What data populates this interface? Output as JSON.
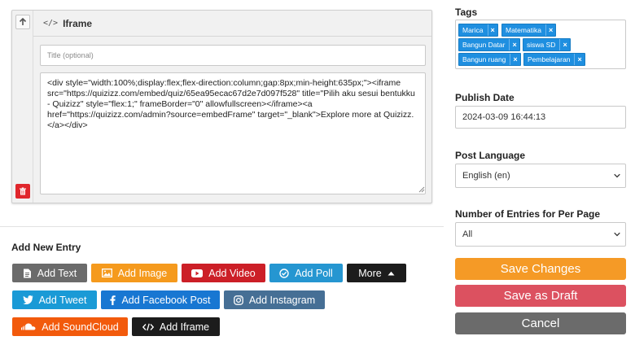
{
  "entry": {
    "header_code_glyph": "</>",
    "header_title": "Iframe",
    "title_placeholder": "Title (optional)",
    "code_value": "<div style=\"width:100%;display:flex;flex-direction:column;gap:8px;min-height:635px;\"><iframe src=\"https://quizizz.com/embed/quiz/65ea95ecac67d2e7d097f528\" title=\"Pilih aku sesui bentukku - Quizizz\" style=\"flex:1;\" frameBorder=\"0\" allowfullscreen></iframe><a href=\"https://quizizz.com/admin?source=embedFrame\" target=\"_blank\">Explore more at Quizizz.</a></div>"
  },
  "add_entry": {
    "title": "Add New Entry",
    "buttons": {
      "text": "Add Text",
      "image": "Add Image",
      "video": "Add Video",
      "poll": "Add Poll",
      "more": "More",
      "tweet": "Add Tweet",
      "facebook": "Add Facebook Post",
      "instagram": "Add Instagram",
      "soundcloud": "Add SoundCloud",
      "iframe": "Add Iframe"
    }
  },
  "sidebar": {
    "tags_label": "Tags",
    "tags": [
      "Marica",
      "Matematika",
      "Bangun Datar",
      "siswa SD",
      "Bangun ruang",
      "Pembelajaran"
    ],
    "tag_remove": "×",
    "publish_date_label": "Publish Date",
    "publish_date_value": "2024-03-09 16:44:13",
    "language_label": "Post Language",
    "language_value": "English (en)",
    "entries_label": "Number of Entries for Per Page",
    "entries_value": "All",
    "save_changes": "Save Changes",
    "save_draft": "Save as Draft",
    "cancel": "Cancel"
  },
  "colors": {
    "gray_button": "#6b6b6b",
    "orange_image": "#f59a1d",
    "red_video": "#cc1f27",
    "blue_poll": "#2596d1",
    "black_more": "#1c1c1c",
    "blue_tweet": "#1a9ad6",
    "blue_facebook": "#1877d2",
    "steel_instagram": "#466f95",
    "orange_soundcloud": "#f25a0c",
    "tag_blue": "#1f8fe0",
    "save_orange": "#f59a26",
    "draft_red": "#dc5160",
    "cancel_gray": "#6b6b6b",
    "delete_red": "#e0262c"
  }
}
